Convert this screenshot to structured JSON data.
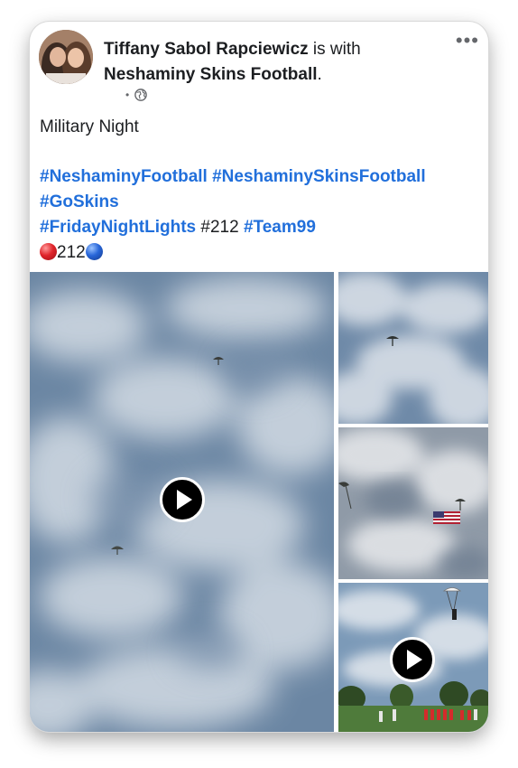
{
  "post": {
    "author": "Tiffany Sabol Rapciewicz",
    "with_text": " is with ",
    "page": "Neshaminy Skins Football",
    "period": ".",
    "meta_dot": "•",
    "more_icon": "more-dots-icon",
    "title_line": "Military Night",
    "hashtags_line1": [
      "#NeshaminyFootball",
      "#NeshaminySkinsFootball"
    ],
    "hashtags_line2": [
      "#GoSkins"
    ],
    "line3_tag1": "#FridayNightLights",
    "line3_plain": "#212",
    "line3_tag2": "#Team99",
    "emoji_line_text": "212",
    "colors": {
      "hashtag": "#216fdb",
      "text": "#1c1e21",
      "meta": "#65676b"
    }
  },
  "media": {
    "tiles": [
      {
        "name": "main-video",
        "has_play": true
      },
      {
        "name": "photo-sky-parachute",
        "has_play": false
      },
      {
        "name": "photo-flag-parachute",
        "has_play": false
      },
      {
        "name": "video-field",
        "has_play": true
      }
    ]
  }
}
